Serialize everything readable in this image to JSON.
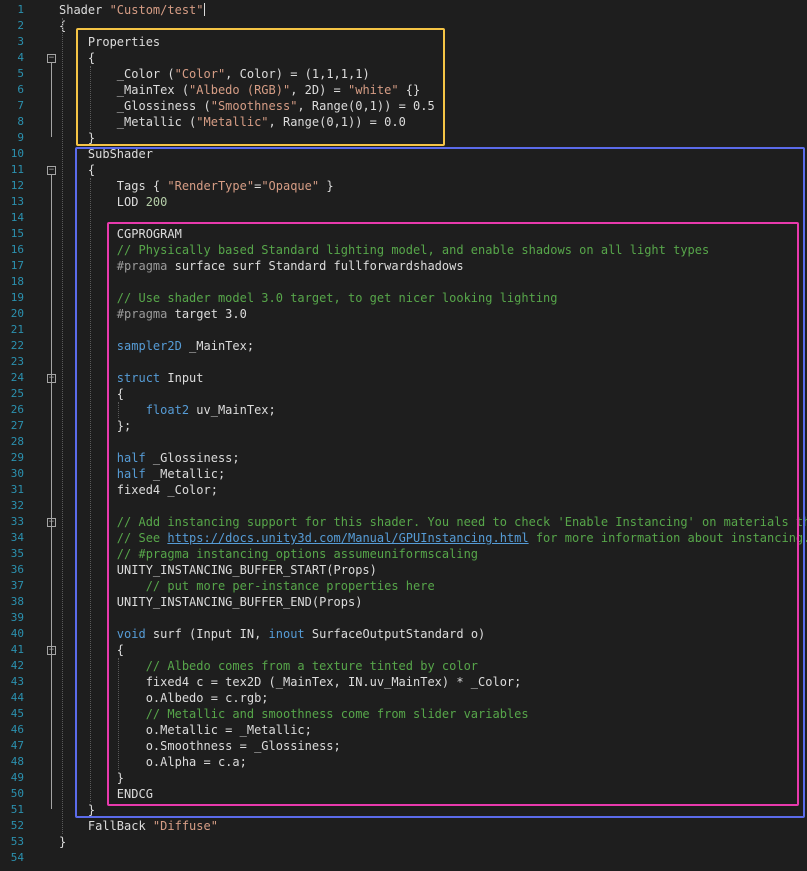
{
  "editor": {
    "colors": {
      "background": "#1e1e1e",
      "line_number": "#2b91af",
      "keyword": "#569cd6",
      "string": "#d69d85",
      "comment": "#57a64a",
      "number": "#b5cea8",
      "pragma": "#9b9b9b",
      "box_properties": "#f5c445",
      "box_subshader": "#5b6bea",
      "box_cgprogram": "#e83aad"
    },
    "lines": [
      {
        "n": "1",
        "tokens": [
          {
            "t": "Shader ",
            "c": "txt"
          },
          {
            "t": "\"Custom/test\"",
            "c": "str"
          }
        ]
      },
      {
        "n": "2",
        "tokens": [
          {
            "t": "{",
            "c": "txt"
          }
        ]
      },
      {
        "n": "3",
        "tokens": [
          {
            "t": "    Properties",
            "c": "txt"
          }
        ]
      },
      {
        "n": "4",
        "tokens": [
          {
            "t": "    {",
            "c": "txt"
          }
        ]
      },
      {
        "n": "5",
        "tokens": [
          {
            "t": "        _Color (",
            "c": "txt"
          },
          {
            "t": "\"Color\"",
            "c": "str"
          },
          {
            "t": ", Color) = (1,1,1,1)",
            "c": "txt"
          }
        ]
      },
      {
        "n": "6",
        "tokens": [
          {
            "t": "        _MainTex (",
            "c": "txt"
          },
          {
            "t": "\"Albedo (RGB)\"",
            "c": "str"
          },
          {
            "t": ", 2D) = ",
            "c": "txt"
          },
          {
            "t": "\"white\"",
            "c": "str"
          },
          {
            "t": " {}",
            "c": "txt"
          }
        ]
      },
      {
        "n": "7",
        "tokens": [
          {
            "t": "        _Glossiness (",
            "c": "txt"
          },
          {
            "t": "\"Smoothness\"",
            "c": "str"
          },
          {
            "t": ", Range(0,1)) = 0.5",
            "c": "txt"
          }
        ]
      },
      {
        "n": "8",
        "tokens": [
          {
            "t": "        _Metallic (",
            "c": "txt"
          },
          {
            "t": "\"Metallic\"",
            "c": "str"
          },
          {
            "t": ", Range(0,1)) = 0.0",
            "c": "txt"
          }
        ]
      },
      {
        "n": "9",
        "tokens": [
          {
            "t": "    }",
            "c": "txt"
          }
        ]
      },
      {
        "n": "10",
        "tokens": [
          {
            "t": "    SubShader",
            "c": "txt"
          }
        ]
      },
      {
        "n": "11",
        "tokens": [
          {
            "t": "    {",
            "c": "txt"
          }
        ]
      },
      {
        "n": "12",
        "tokens": [
          {
            "t": "        Tags { ",
            "c": "txt"
          },
          {
            "t": "\"RenderType\"",
            "c": "str"
          },
          {
            "t": "=",
            "c": "txt"
          },
          {
            "t": "\"Opaque\"",
            "c": "str"
          },
          {
            "t": " }",
            "c": "txt"
          }
        ]
      },
      {
        "n": "13",
        "tokens": [
          {
            "t": "        LOD ",
            "c": "txt"
          },
          {
            "t": "200",
            "c": "num"
          }
        ]
      },
      {
        "n": "14",
        "tokens": []
      },
      {
        "n": "15",
        "tokens": [
          {
            "t": "        CGPROGRAM",
            "c": "txt"
          }
        ]
      },
      {
        "n": "16",
        "tokens": [
          {
            "t": "        // Physically based Standard lighting model, and enable shadows on all light types",
            "c": "cm"
          }
        ]
      },
      {
        "n": "17",
        "tokens": [
          {
            "t": "        #pragma",
            "c": "pp"
          },
          {
            "t": " surface surf Standard fullforwardshadows",
            "c": "txt"
          }
        ]
      },
      {
        "n": "18",
        "tokens": []
      },
      {
        "n": "19",
        "tokens": [
          {
            "t": "        // Use shader model 3.0 target, to get nicer looking lighting",
            "c": "cm"
          }
        ]
      },
      {
        "n": "20",
        "tokens": [
          {
            "t": "        #pragma",
            "c": "pp"
          },
          {
            "t": " target 3.0",
            "c": "txt"
          }
        ]
      },
      {
        "n": "21",
        "tokens": []
      },
      {
        "n": "22",
        "tokens": [
          {
            "t": "        ",
            "c": "txt"
          },
          {
            "t": "sampler2D",
            "c": "kw"
          },
          {
            "t": " _MainTex;",
            "c": "txt"
          }
        ]
      },
      {
        "n": "23",
        "tokens": []
      },
      {
        "n": "24",
        "tokens": [
          {
            "t": "        ",
            "c": "txt"
          },
          {
            "t": "struct",
            "c": "kw"
          },
          {
            "t": " Input",
            "c": "txt"
          }
        ]
      },
      {
        "n": "25",
        "tokens": [
          {
            "t": "        {",
            "c": "txt"
          }
        ]
      },
      {
        "n": "26",
        "tokens": [
          {
            "t": "            ",
            "c": "txt"
          },
          {
            "t": "float2",
            "c": "kw"
          },
          {
            "t": " uv_MainTex;",
            "c": "txt"
          }
        ]
      },
      {
        "n": "27",
        "tokens": [
          {
            "t": "        };",
            "c": "txt"
          }
        ]
      },
      {
        "n": "28",
        "tokens": []
      },
      {
        "n": "29",
        "tokens": [
          {
            "t": "        ",
            "c": "txt"
          },
          {
            "t": "half",
            "c": "kw"
          },
          {
            "t": " _Glossiness;",
            "c": "txt"
          }
        ]
      },
      {
        "n": "30",
        "tokens": [
          {
            "t": "        ",
            "c": "txt"
          },
          {
            "t": "half",
            "c": "kw"
          },
          {
            "t": " _Metallic;",
            "c": "txt"
          }
        ]
      },
      {
        "n": "31",
        "tokens": [
          {
            "t": "        fixed4 _Color;",
            "c": "txt"
          }
        ]
      },
      {
        "n": "32",
        "tokens": []
      },
      {
        "n": "33",
        "tokens": [
          {
            "t": "        // Add instancing support for this shader. You need to check 'Enable Instancing' on materials that use the shader.",
            "c": "cm"
          }
        ]
      },
      {
        "n": "34",
        "tokens": [
          {
            "t": "        // See ",
            "c": "cm"
          },
          {
            "t": "https://docs.unity3d.com/Manual/GPUInstancing.html",
            "c": "link"
          },
          {
            "t": " for more information about instancing.",
            "c": "cm"
          }
        ]
      },
      {
        "n": "35",
        "tokens": [
          {
            "t": "        // #pragma instancing_options assumeuniformscaling",
            "c": "cm"
          }
        ]
      },
      {
        "n": "36",
        "tokens": [
          {
            "t": "        UNITY_INSTANCING_BUFFER_START(Props)",
            "c": "txt"
          }
        ]
      },
      {
        "n": "37",
        "tokens": [
          {
            "t": "            // put more per-instance properties here",
            "c": "cm"
          }
        ]
      },
      {
        "n": "38",
        "tokens": [
          {
            "t": "        UNITY_INSTANCING_BUFFER_END(Props)",
            "c": "txt"
          }
        ]
      },
      {
        "n": "39",
        "tokens": []
      },
      {
        "n": "40",
        "tokens": [
          {
            "t": "        ",
            "c": "txt"
          },
          {
            "t": "void",
            "c": "kw"
          },
          {
            "t": " surf (Input IN, ",
            "c": "txt"
          },
          {
            "t": "inout",
            "c": "kw"
          },
          {
            "t": " SurfaceOutputStandard o)",
            "c": "txt"
          }
        ]
      },
      {
        "n": "41",
        "tokens": [
          {
            "t": "        {",
            "c": "txt"
          }
        ]
      },
      {
        "n": "42",
        "tokens": [
          {
            "t": "            // Albedo comes from a texture tinted by color",
            "c": "cm"
          }
        ]
      },
      {
        "n": "43",
        "tokens": [
          {
            "t": "            fixed4 c = tex2D (_MainTex, IN.uv_MainTex) * _Color;",
            "c": "txt"
          }
        ]
      },
      {
        "n": "44",
        "tokens": [
          {
            "t": "            o.Albedo = c.rgb;",
            "c": "txt"
          }
        ]
      },
      {
        "n": "45",
        "tokens": [
          {
            "t": "            // Metallic and smoothness come from slider variables",
            "c": "cm"
          }
        ]
      },
      {
        "n": "46",
        "tokens": [
          {
            "t": "            o.Metallic = _Metallic;",
            "c": "txt"
          }
        ]
      },
      {
        "n": "47",
        "tokens": [
          {
            "t": "            o.Smoothness = _Glossiness;",
            "c": "txt"
          }
        ]
      },
      {
        "n": "48",
        "tokens": [
          {
            "t": "            o.Alpha = c.a;",
            "c": "txt"
          }
        ]
      },
      {
        "n": "49",
        "tokens": [
          {
            "t": "        }",
            "c": "txt"
          }
        ]
      },
      {
        "n": "50",
        "tokens": [
          {
            "t": "        ENDCG",
            "c": "txt"
          }
        ]
      },
      {
        "n": "51",
        "tokens": [
          {
            "t": "    }",
            "c": "txt"
          }
        ]
      },
      {
        "n": "52",
        "tokens": [
          {
            "t": "    FallBack ",
            "c": "txt"
          },
          {
            "t": "\"Diffuse\"",
            "c": "str"
          }
        ]
      },
      {
        "n": "53",
        "tokens": [
          {
            "t": "}",
            "c": "txt"
          }
        ]
      },
      {
        "n": "54",
        "tokens": []
      }
    ]
  }
}
